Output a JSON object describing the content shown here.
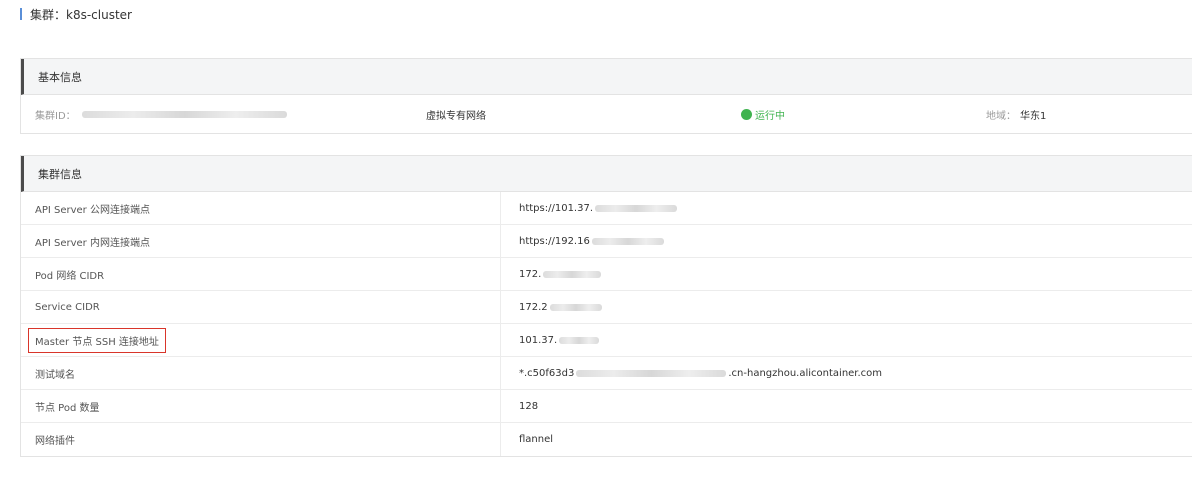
{
  "header": {
    "title": "集群：k8s-cluster"
  },
  "basic_info": {
    "heading": "基本信息",
    "cluster_id_label": "集群ID：",
    "network_type": "虚拟专有网络",
    "status": "运行中",
    "status_color": "#3fb34f",
    "region_label": "地域：",
    "region_value": "华东1"
  },
  "cluster_info": {
    "heading": "集群信息",
    "rows": [
      {
        "label": "API Server 公网连接端点",
        "value": "https://101.37."
      },
      {
        "label": "API Server 内网连接端点",
        "value": "https://192.16"
      },
      {
        "label": "Pod 网络 CIDR",
        "value": "172."
      },
      {
        "label": "Service CIDR",
        "value": "172.2"
      },
      {
        "label": "Master 节点 SSH 连接地址",
        "value": "101.37."
      },
      {
        "label": "测试域名",
        "value_prefix": "*.c50f63d3",
        "value_suffix": ".cn-hangzhou.alicontainer.com"
      },
      {
        "label": "节点 Pod 数量",
        "value": "128"
      },
      {
        "label": "网络插件",
        "value": "flannel"
      }
    ]
  },
  "colors": {
    "highlight_border": "#d9352a",
    "panel_header_bg": "#f4f5f6",
    "accent": "#5a8fd8"
  }
}
